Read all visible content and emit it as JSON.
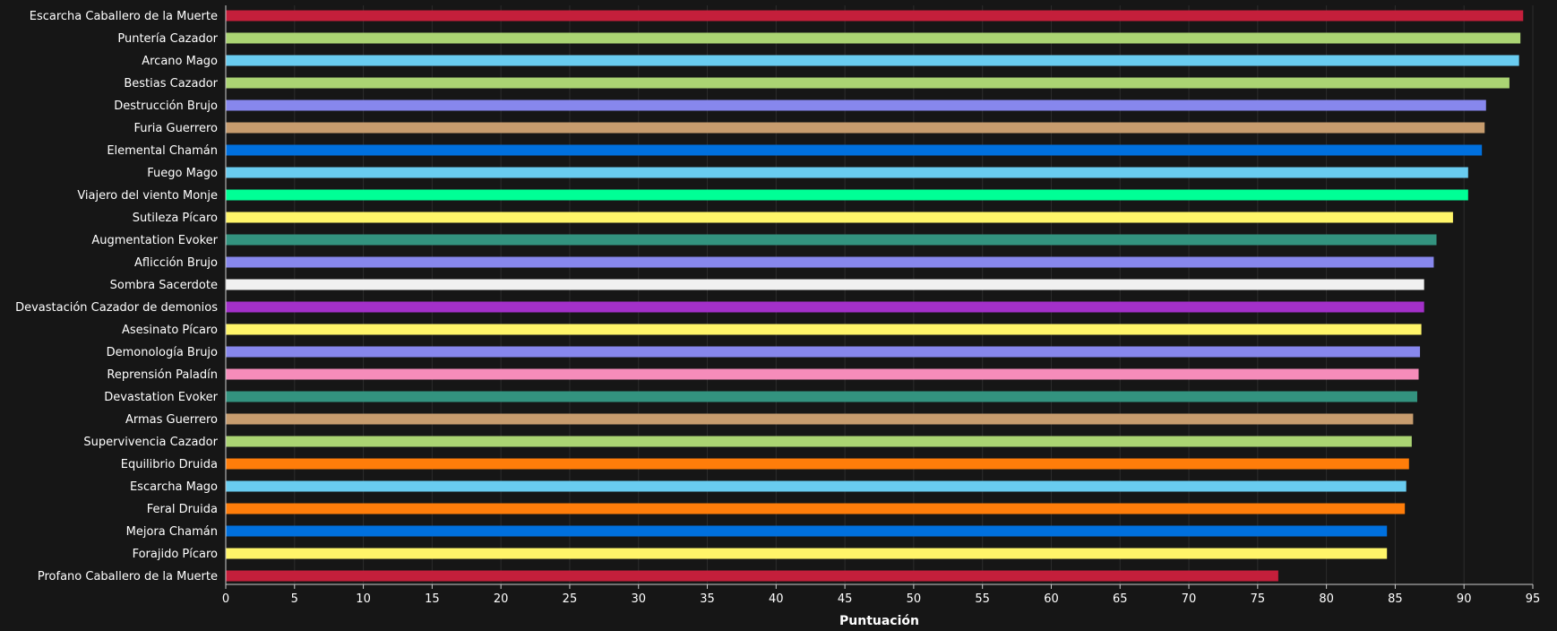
{
  "chart_data": {
    "type": "bar",
    "orientation": "horizontal",
    "xlabel": "Puntuación",
    "ylabel": "",
    "xlim": [
      0,
      95
    ],
    "xticks": [
      "0",
      "5",
      "10",
      "15",
      "20",
      "25",
      "30",
      "35",
      "40",
      "45",
      "50",
      "55",
      "60",
      "65",
      "70",
      "75",
      "80",
      "85",
      "90",
      "95"
    ],
    "grid": "vertical",
    "categories": [
      "Escarcha Caballero de la Muerte",
      "Puntería Cazador",
      "Arcano Mago",
      "Bestias Cazador",
      "Destrucción Brujo",
      "Furia Guerrero",
      "Elemental Chamán",
      "Fuego Mago",
      "Viajero del viento Monje",
      "Sutileza Pícaro",
      "Augmentation Evoker",
      "Aflicción Brujo",
      "Sombra Sacerdote",
      "Devastación Cazador de demonios",
      "Asesinato Pícaro",
      "Demonología Brujo",
      "Reprensión Paladín",
      "Devastation Evoker",
      "Armas Guerrero",
      "Supervivencia Cazador",
      "Equilibrio Druida",
      "Escarcha Mago",
      "Feral Druida",
      "Mejora Chamán",
      "Forajido Pícaro",
      "Profano Caballero de la Muerte"
    ],
    "values": [
      94.3,
      94.1,
      94.0,
      93.3,
      91.6,
      91.5,
      91.3,
      90.3,
      90.3,
      89.2,
      88.0,
      87.8,
      87.1,
      87.1,
      86.9,
      86.8,
      86.7,
      86.6,
      86.3,
      86.2,
      86.0,
      85.8,
      85.7,
      84.4,
      84.4,
      76.5
    ],
    "colors": [
      "#c41f3b",
      "#abd473",
      "#69ccf0",
      "#abd473",
      "#8787ed",
      "#c79c6e",
      "#0070de",
      "#69ccf0",
      "#00ff96",
      "#fff569",
      "#33937f",
      "#8787ed",
      "#f0f0f0",
      "#a330c9",
      "#fff569",
      "#8787ed",
      "#f58cba",
      "#33937f",
      "#c79c6e",
      "#abd473",
      "#ff7d0a",
      "#69ccf0",
      "#ff7d0a",
      "#0070de",
      "#fff569",
      "#c41f3b"
    ]
  }
}
